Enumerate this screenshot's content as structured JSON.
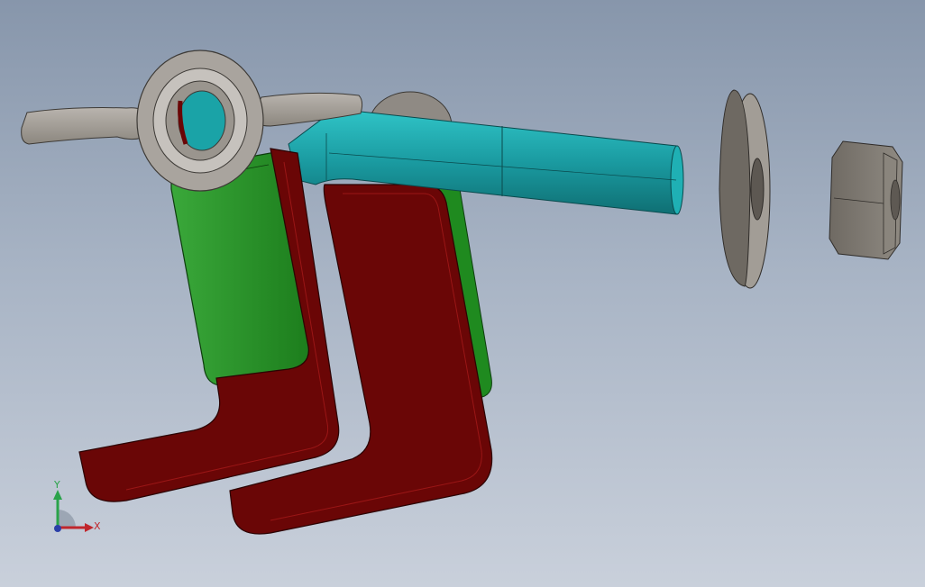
{
  "viewport": {
    "background_top": "#8796ab",
    "background_bottom": "#c9d0db"
  },
  "parts": [
    {
      "name": "wing-nut",
      "color": "#8a8580"
    },
    {
      "name": "bolt-shaft",
      "color": "#1a9aa0"
    },
    {
      "name": "clamp-jaw-front",
      "color": "#6a0606"
    },
    {
      "name": "clamp-jaw-back",
      "color": "#6a0606"
    },
    {
      "name": "clamp-plate-green",
      "color": "#1f8a1f"
    },
    {
      "name": "flat-washer",
      "color": "#7c776f"
    },
    {
      "name": "hex-nut",
      "color": "#78736b"
    }
  ],
  "triad": {
    "x_label": "X",
    "y_label": "Y",
    "x_color": "#c0262c",
    "y_color": "#2aa34a",
    "z_color": "#2b3fa8"
  }
}
